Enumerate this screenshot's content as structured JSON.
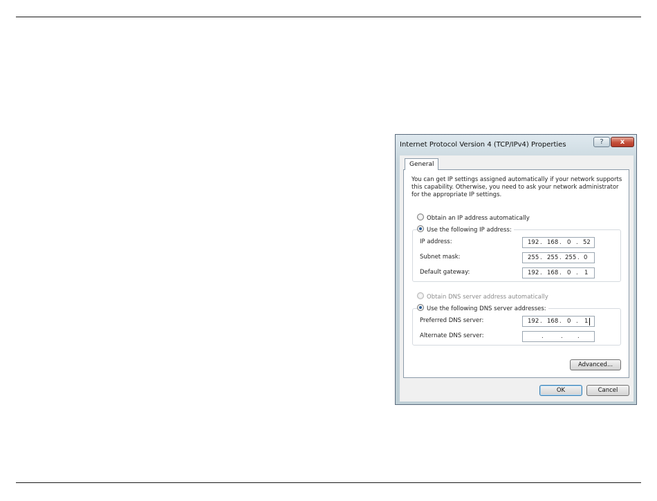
{
  "dialog": {
    "title": "Internet Protocol Version 4 (TCP/IPv4) Properties",
    "help_glyph": "?",
    "close_glyph": "x",
    "tab_general": "General",
    "description": "You can get IP settings assigned automatically if your network supports this capability. Otherwise, you need to ask your network administrator for the appropriate IP settings.",
    "ip_auto_label": "Obtain an IP address automatically",
    "ip_manual_label": "Use the following IP address:",
    "ip_address_label": "IP address:",
    "ip_address": [
      "192",
      "168",
      "0",
      "52"
    ],
    "subnet_label": "Subnet mask:",
    "subnet": [
      "255",
      "255",
      "255",
      "0"
    ],
    "gateway_label": "Default gateway:",
    "gateway": [
      "192",
      "168",
      "0",
      "1"
    ],
    "dns_auto_label": "Obtain DNS server address automatically",
    "dns_manual_label": "Use the following DNS server addresses:",
    "preferred_dns_label": "Preferred DNS server:",
    "preferred_dns": [
      "192",
      "168",
      "0",
      "1"
    ],
    "alternate_dns_label": "Alternate DNS server:",
    "alternate_dns": [
      "",
      "",
      "",
      ""
    ],
    "dot": ".",
    "advanced_label": "Advanced...",
    "ok_label": "OK",
    "cancel_label": "Cancel",
    "ip_mode": "manual",
    "dns_mode": "manual"
  },
  "colors": {
    "title_bar": "#c9d7de",
    "close_button": "#c5503b",
    "radio_selected": "#2b5c93"
  }
}
